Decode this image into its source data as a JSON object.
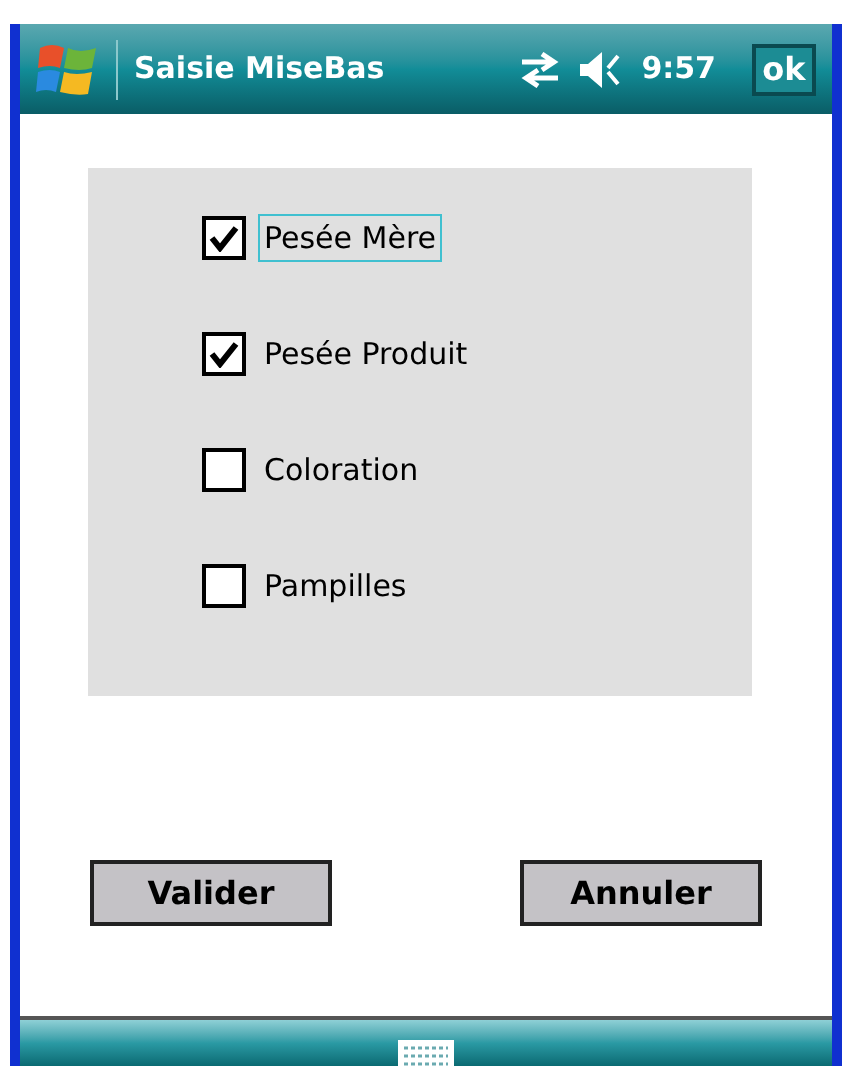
{
  "title_bar": {
    "title": "Saisie MiseBas",
    "time": "9:57",
    "ok_button": "ok"
  },
  "options": [
    {
      "label": "Pesée Mère",
      "checked": true,
      "selected": true
    },
    {
      "label": "Pesée Produit",
      "checked": true,
      "selected": false
    },
    {
      "label": "Coloration",
      "checked": false,
      "selected": false
    },
    {
      "label": "Pampilles",
      "checked": false,
      "selected": false
    }
  ],
  "buttons": [
    "Valider",
    "Annuler"
  ]
}
